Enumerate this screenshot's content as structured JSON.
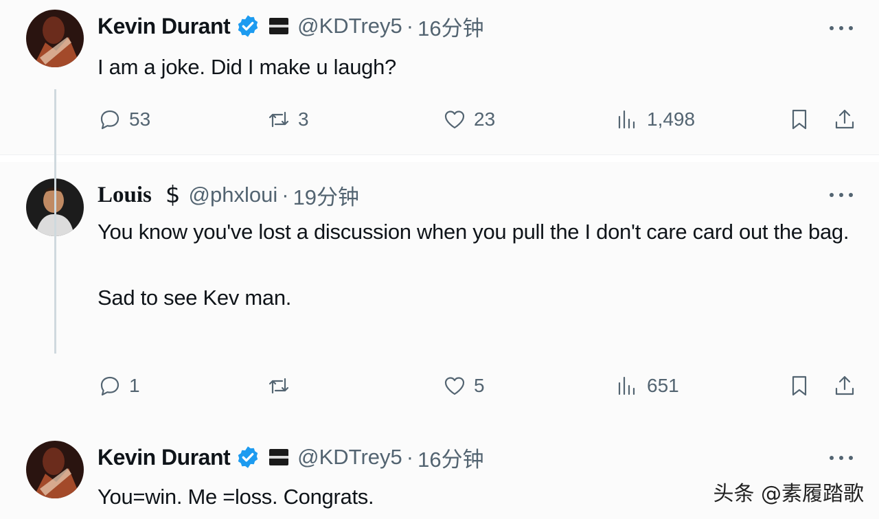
{
  "tweets": [
    {
      "author": {
        "name": "Kevin Durant",
        "handle": "@KDTrey5",
        "verified": true,
        "flag_icon": "black-flag-icon",
        "time": "16分钟"
      },
      "sep": "·",
      "text": "I am a joke. Did I make u laugh?",
      "actions": {
        "replies": "53",
        "retweets": "3",
        "likes": "23",
        "views": "1,498"
      }
    },
    {
      "author": {
        "name": "Louis",
        "emoji": "$",
        "handle": "@phxloui",
        "time": "19分钟"
      },
      "sep": "·",
      "text": "You know you've lost a discussion when you pull the I don't care card out the bag.\n\nSad to see Kev man.",
      "actions": {
        "replies": "1",
        "retweets": "",
        "likes": "5",
        "views": "651"
      }
    },
    {
      "author": {
        "name": "Kevin Durant",
        "handle": "@KDTrey5",
        "verified": true,
        "flag_icon": "black-flag-icon",
        "time": "16分钟"
      },
      "sep": "·",
      "text": "You=win. Me =loss. Congrats."
    }
  ],
  "watermark": "头条 @素履踏歌",
  "colors": {
    "verified_blue": "#1d9bf0",
    "muted": "#536471",
    "text": "#0f1419"
  }
}
